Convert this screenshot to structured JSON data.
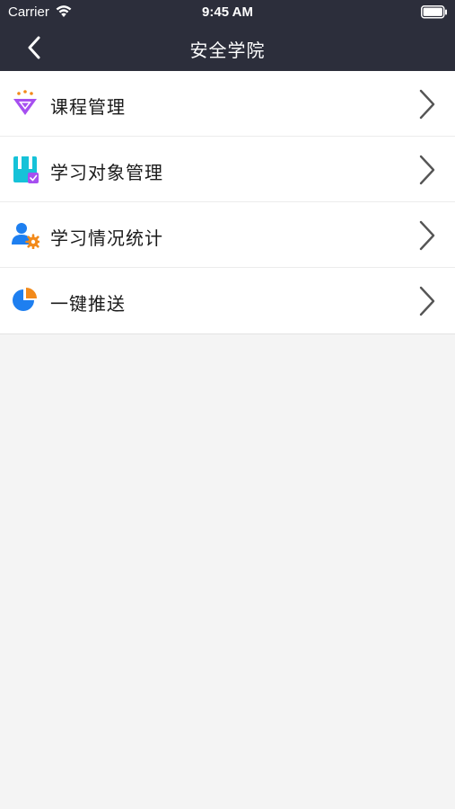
{
  "status_bar": {
    "carrier": "Carrier",
    "time": "9:45 AM",
    "wifi_icon": "wifi-icon",
    "battery_icon": "battery-icon"
  },
  "nav": {
    "title": "安全学院",
    "back_icon": "chevron-left-icon"
  },
  "menu": {
    "items": [
      {
        "label": "课程管理",
        "icon": "diamond-icon",
        "icon_color": "#a64ff0"
      },
      {
        "label": "学习对象管理",
        "icon": "book-icon",
        "icon_color": "#16c2d8"
      },
      {
        "label": "学习情况统计",
        "icon": "user-settings-icon",
        "icon_color": "#1e7ff0"
      },
      {
        "label": "一键推送",
        "icon": "pie-chart-icon",
        "icon_color": "#1e7ff0"
      }
    ],
    "chevron_icon": "chevron-right-icon"
  },
  "colors": {
    "header_bg": "#2c2e3b",
    "page_bg": "#f4f4f4",
    "accent_orange": "#f28a1b"
  }
}
